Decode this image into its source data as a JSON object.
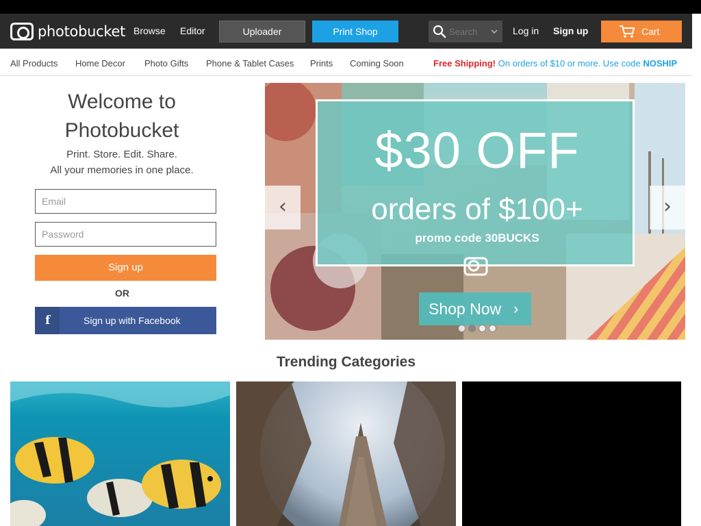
{
  "header": {
    "logo_text": "photobucket",
    "browse": "Browse",
    "editor": "Editor",
    "uploader": "Uploader",
    "print_shop": "Print Shop",
    "search_placeholder": "Search",
    "login": "Log in",
    "signup": "Sign up",
    "cart": "Cart"
  },
  "subnav": {
    "items": [
      "All Products",
      "Home Decor",
      "Photo Gifts",
      "Phone & Tablet Cases",
      "Prints",
      "Coming Soon"
    ],
    "promo_red": "Free Shipping!",
    "promo_text": "On orders of $10 or more. Use code",
    "promo_code": "NOSHIP"
  },
  "welcome": {
    "title_line1": "Welcome to",
    "title_line2": "Photobucket",
    "sub_line1": "Print. Store. Edit. Share.",
    "sub_line2": "All your memories in one place.",
    "email_placeholder": "Email",
    "password_placeholder": "Password",
    "signup_button": "Sign up",
    "or": "OR",
    "facebook_button": "Sign up with Facebook",
    "facebook_icon": "f"
  },
  "hero": {
    "headline": "$30 OFF",
    "subline": "orders of $100+",
    "promo": "promo code 30BUCKS",
    "cta": "Shop Now",
    "cta_arrow": "›",
    "prev_arrow": "‹",
    "next_arrow": "›",
    "slide_count": 4,
    "active_slide": 2
  },
  "trending": {
    "title": "Trending Categories"
  },
  "colors": {
    "nav_bg": "#2b2b2b",
    "accent_orange": "#f58a3b",
    "accent_blue": "#1da1e5",
    "facebook_blue": "#3b5998",
    "promo_red": "#e0262b"
  }
}
